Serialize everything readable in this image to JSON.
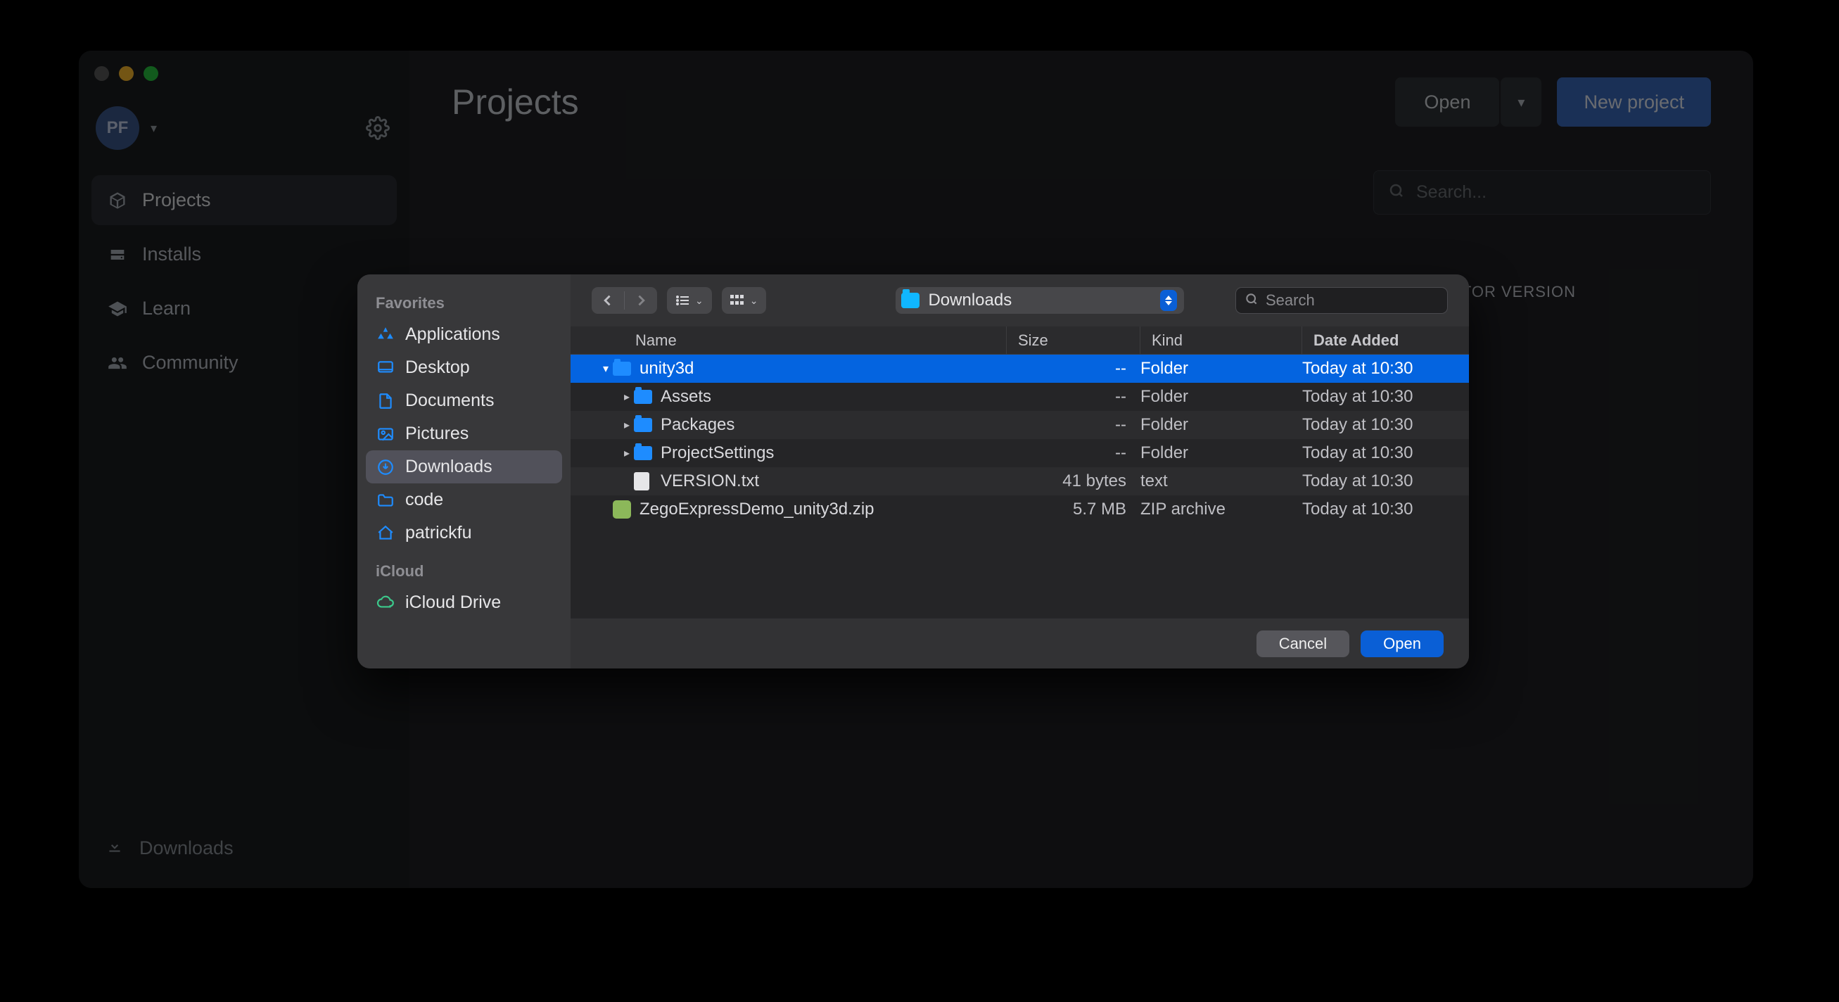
{
  "hub": {
    "title": "Projects",
    "avatar_initials": "PF",
    "nav": [
      {
        "label": "Projects"
      },
      {
        "label": "Installs"
      },
      {
        "label": "Learn"
      },
      {
        "label": "Community"
      }
    ],
    "bottom_label": "Downloads",
    "open_label": "Open",
    "new_project_label": "New project",
    "search_placeholder": "Search...",
    "column_editor_version": "EDITOR VERSION"
  },
  "finder": {
    "sidebar": {
      "favorites_heading": "Favorites",
      "favorites": [
        {
          "label": "Applications",
          "icon": "apps"
        },
        {
          "label": "Desktop",
          "icon": "desktop"
        },
        {
          "label": "Documents",
          "icon": "doc"
        },
        {
          "label": "Pictures",
          "icon": "pic"
        },
        {
          "label": "Downloads",
          "icon": "download",
          "selected": true
        },
        {
          "label": "code",
          "icon": "folder"
        },
        {
          "label": "patrickfu",
          "icon": "home"
        }
      ],
      "icloud_heading": "iCloud",
      "icloud": [
        {
          "label": "iCloud Drive",
          "icon": "cloud"
        }
      ]
    },
    "location_label": "Downloads",
    "search_placeholder": "Search",
    "columns": {
      "name": "Name",
      "size": "Size",
      "kind": "Kind",
      "date": "Date Added"
    },
    "rows": [
      {
        "name": "unity3d",
        "size": "--",
        "kind": "Folder",
        "date": "Today at 10:30",
        "icon": "folder",
        "selected": true,
        "expanded": true,
        "indent": 0
      },
      {
        "name": "Assets",
        "size": "--",
        "kind": "Folder",
        "date": "Today at 10:30",
        "icon": "folder",
        "expandable": true,
        "indent": 1
      },
      {
        "name": "Packages",
        "size": "--",
        "kind": "Folder",
        "date": "Today at 10:30",
        "icon": "folder",
        "expandable": true,
        "indent": 1
      },
      {
        "name": "ProjectSettings",
        "size": "--",
        "kind": "Folder",
        "date": "Today at 10:30",
        "icon": "folder",
        "expandable": true,
        "indent": 1
      },
      {
        "name": "VERSION.txt",
        "size": "41 bytes",
        "kind": "text",
        "date": "Today at 10:30",
        "icon": "file",
        "indent": 1
      },
      {
        "name": "ZegoExpressDemo_unity3d.zip",
        "size": "5.7 MB",
        "kind": "ZIP archive",
        "date": "Today at 10:30",
        "icon": "zip",
        "indent": 0
      }
    ],
    "cancel_label": "Cancel",
    "open_label": "Open"
  }
}
